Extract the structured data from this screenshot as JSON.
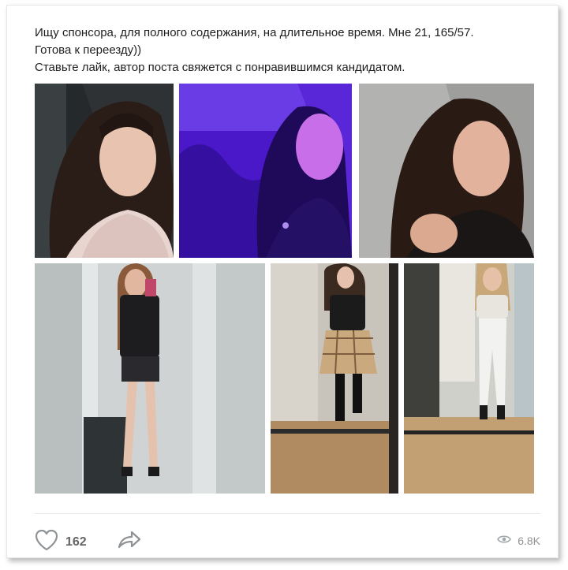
{
  "post": {
    "text_line1": "Ищу спонсора, для полного содержания, на длительное время. Мне 21, 165/57.",
    "text_line2": "Готова к переезду))",
    "text_line3": "Ставьте лайк, автор поста свяжется с понравившимся кандидатом."
  },
  "photos": [
    {
      "id": "photo-1",
      "theme": "selfie-light-top"
    },
    {
      "id": "photo-2",
      "theme": "selfie-purple-light"
    },
    {
      "id": "photo-3",
      "theme": "selfie-black-top"
    },
    {
      "id": "photo-4",
      "theme": "mirror-shorts"
    },
    {
      "id": "photo-5",
      "theme": "mirror-plaid-skirt"
    },
    {
      "id": "photo-6",
      "theme": "mirror-white-jeans"
    }
  ],
  "footer": {
    "likes": "162",
    "views": "6.8K",
    "like_icon": "heart-icon",
    "share_icon": "share-arrow-icon",
    "views_icon": "eye-icon"
  },
  "colors": {
    "text": "#1f1f1f",
    "icon": "#8f9396",
    "counter": "#656565",
    "views": "#939393"
  }
}
